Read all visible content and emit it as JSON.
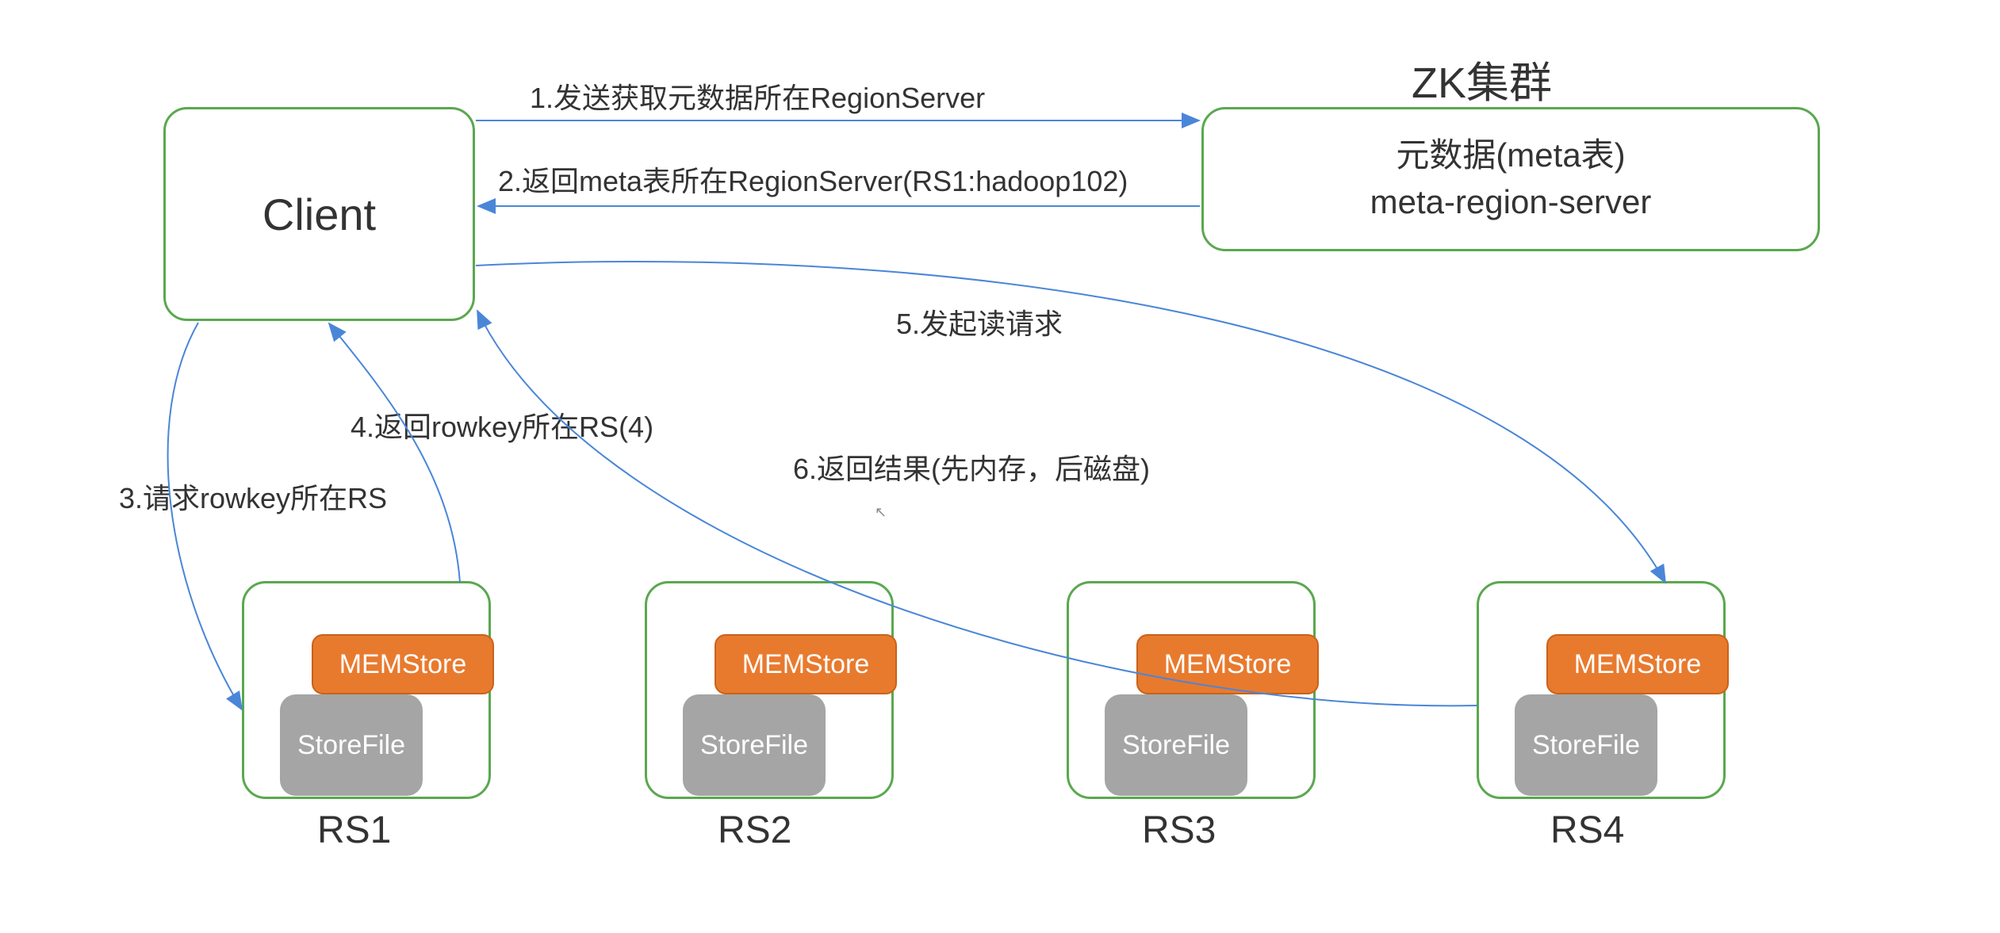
{
  "client": {
    "label": "Client"
  },
  "zk": {
    "title": "ZK集群",
    "line1": "元数据(meta表)",
    "line2": "meta-region-server"
  },
  "rs": {
    "memstore_label": "MEMStore",
    "storefile_label": "StoreFile",
    "rs1_label": "RS1",
    "rs2_label": "RS2",
    "rs3_label": "RS3",
    "rs4_label": "RS4"
  },
  "edges": {
    "e1": "1.发送获取元数据所在RegionServer",
    "e2": "2.返回meta表所在RegionServer(RS1:hadoop102)",
    "e3": "3.请求rowkey所在RS",
    "e4": "4.返回rowkey所在RS(4)",
    "e5": "5.发起读请求",
    "e6": "6.返回结果(先内存，后磁盘)"
  }
}
